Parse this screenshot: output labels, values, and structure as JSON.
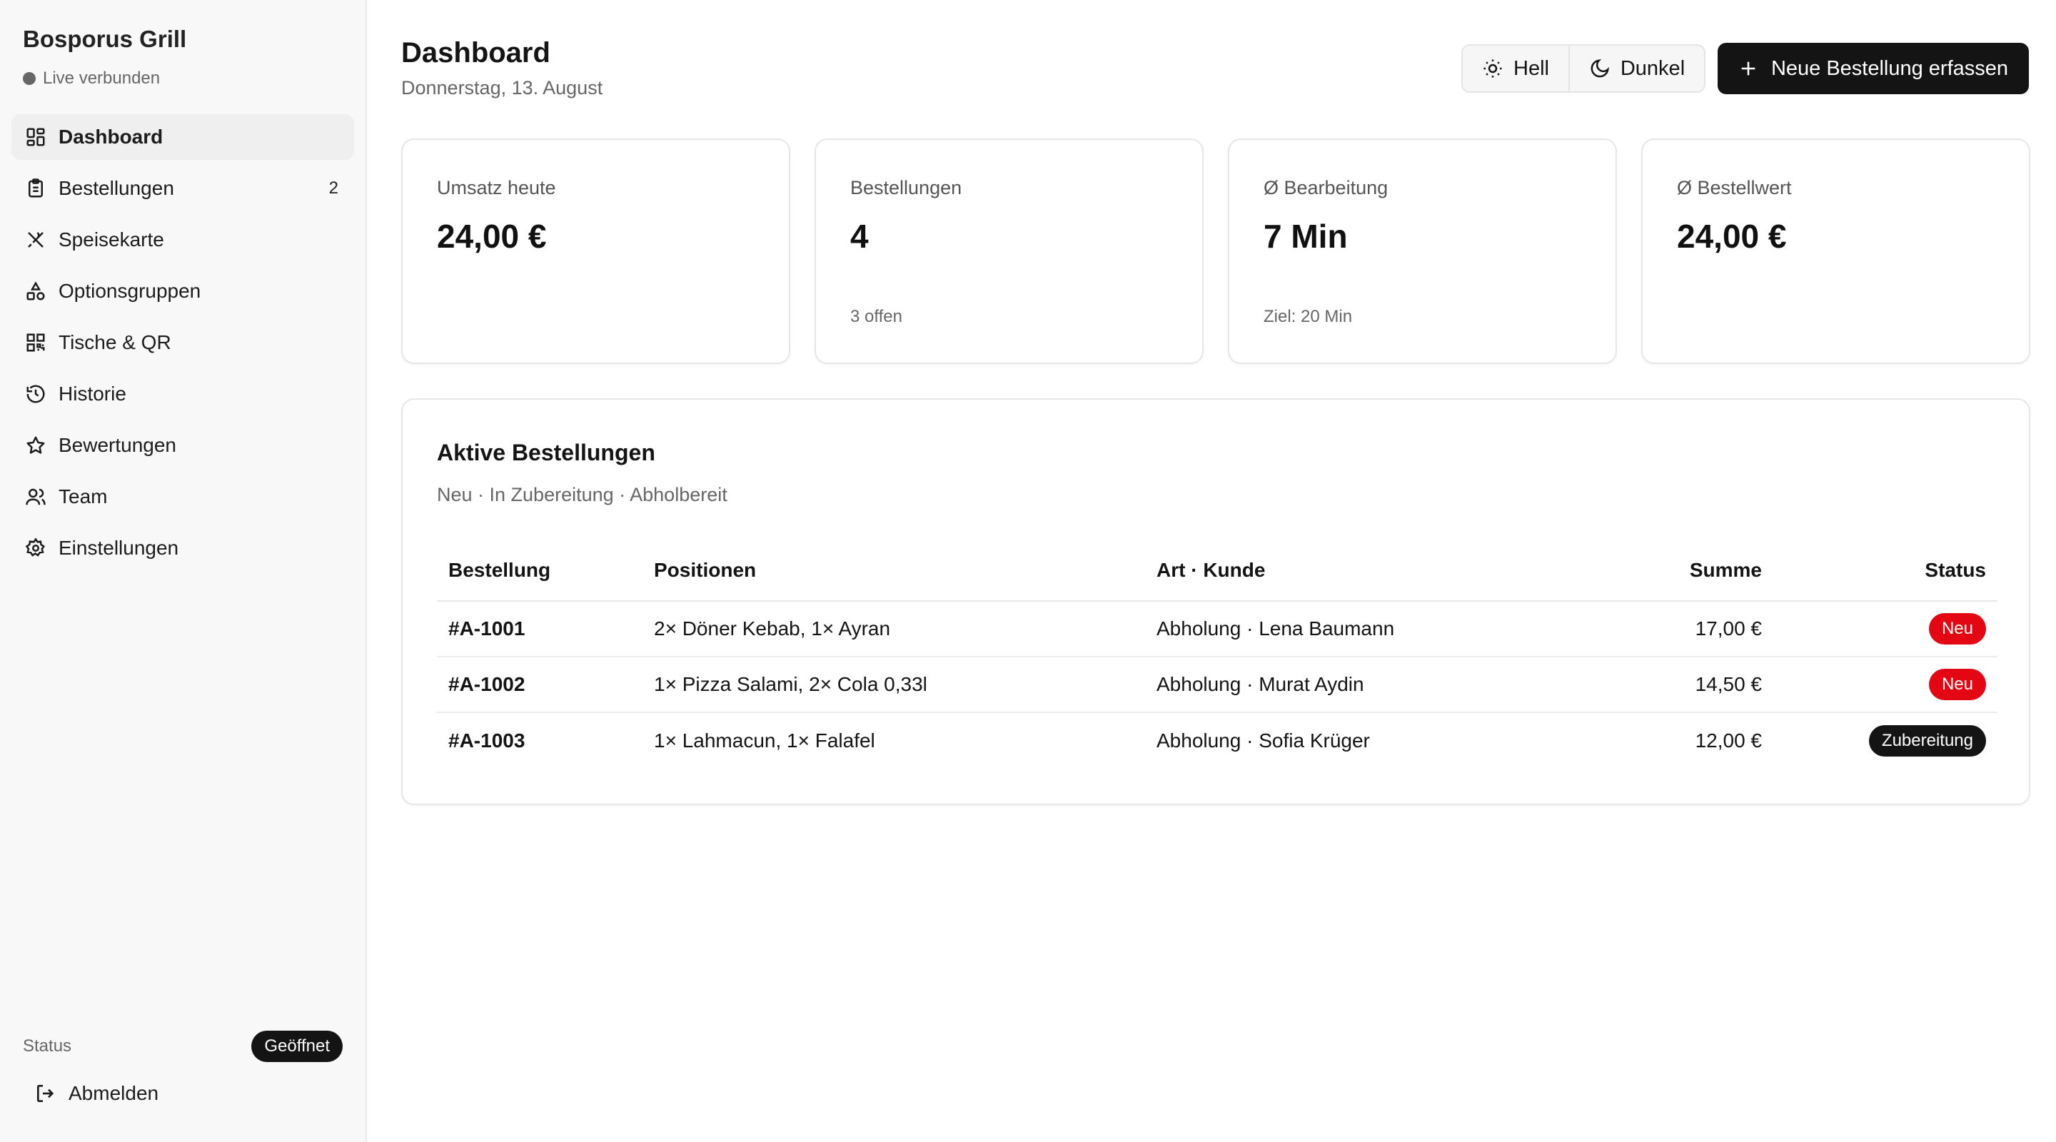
{
  "sidebar": {
    "brand": "Bosporus Grill",
    "live_status": "Live verbunden",
    "items": [
      {
        "label": "Dashboard",
        "icon": "dashboard-icon",
        "active": true,
        "count": ""
      },
      {
        "label": "Bestellungen",
        "icon": "clipboard-icon",
        "active": false,
        "count": "2"
      },
      {
        "label": "Speisekarte",
        "icon": "utensils-icon",
        "active": false,
        "count": ""
      },
      {
        "label": "Optionsgruppen",
        "icon": "shapes-icon",
        "active": false,
        "count": ""
      },
      {
        "label": "Tische & QR",
        "icon": "qr-code-icon",
        "active": false,
        "count": ""
      },
      {
        "label": "Historie",
        "icon": "history-icon",
        "active": false,
        "count": ""
      },
      {
        "label": "Bewertungen",
        "icon": "star-icon",
        "active": false,
        "count": ""
      },
      {
        "label": "Team",
        "icon": "users-icon",
        "active": false,
        "count": ""
      },
      {
        "label": "Einstellungen",
        "icon": "gear-icon",
        "active": false,
        "count": ""
      }
    ],
    "status_label": "Status",
    "status_value": "Geöffnet",
    "logout_label": "Abmelden"
  },
  "header": {
    "title": "Dashboard",
    "date": "Donnerstag, 13. August",
    "theme_light": "Hell",
    "theme_dark": "Dunkel",
    "new_order": "Neue Bestellung erfassen"
  },
  "stats": [
    {
      "title": "Umsatz heute",
      "value": "24,00 €",
      "sub": ""
    },
    {
      "title": "Bestellungen",
      "value": "4",
      "sub": "3 offen"
    },
    {
      "title": "Ø Bearbeitung",
      "value": "7 Min",
      "sub": "Ziel: 20 Min"
    },
    {
      "title": "Ø Bestellwert",
      "value": "24,00 €",
      "sub": ""
    }
  ],
  "orders": {
    "title": "Aktive Bestellungen",
    "subtitle": "Neu · In Zubereitung · Abholbereit",
    "columns": [
      "Bestellung",
      "Positionen",
      "Art · Kunde",
      "Summe",
      "Status"
    ],
    "rows": [
      {
        "id": "#A-1001",
        "items": "2× Döner Kebab, 1× Ayran",
        "customer": "Abholung · Lena Baumann",
        "sum": "17,00 €",
        "status": "Neu"
      },
      {
        "id": "#A-1002",
        "items": "1× Pizza Salami, 2× Cola 0,33l",
        "customer": "Abholung · Murat Aydin",
        "sum": "14,50 €",
        "status": "Neu"
      },
      {
        "id": "#A-1003",
        "items": "1× Lahmacun, 1× Falafel",
        "customer": "Abholung · Sofia Krüger",
        "sum": "12,00 €",
        "status": "Zubereitung"
      }
    ]
  },
  "colors": {
    "accent_dark": "#141414",
    "badge_new": "#e30613",
    "sidebar_bg": "#f8f8f8"
  }
}
